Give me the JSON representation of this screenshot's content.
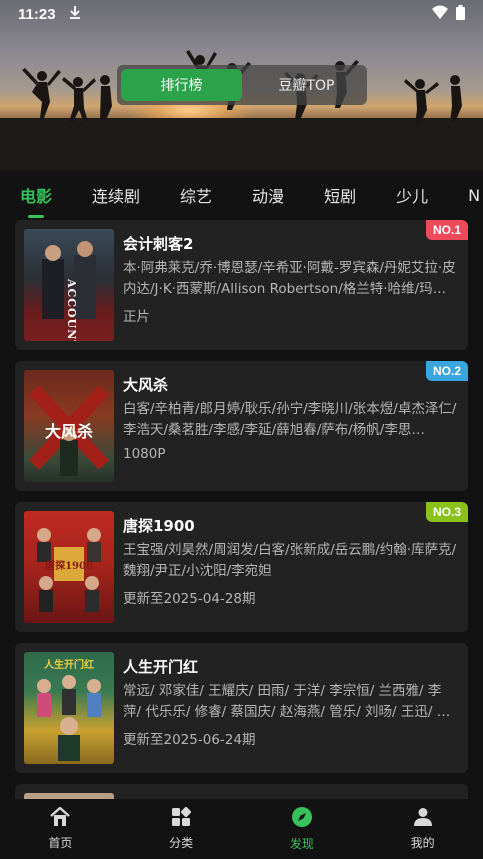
{
  "status_bar": {
    "time": "11:23"
  },
  "header": {
    "segments": [
      {
        "label": "排行榜",
        "active": true
      },
      {
        "label": "豆瓣TOP",
        "active": false
      }
    ]
  },
  "category_tabs": [
    {
      "label": "电影",
      "active": true
    },
    {
      "label": "连续剧",
      "active": false
    },
    {
      "label": "综艺",
      "active": false
    },
    {
      "label": "动漫",
      "active": false
    },
    {
      "label": "短剧",
      "active": false
    },
    {
      "label": "少儿",
      "active": false
    },
    {
      "label": "N",
      "active": false
    }
  ],
  "items": [
    {
      "rank": "NO.1",
      "rank_color": "#ef4a5a",
      "title": "会计刺客2",
      "cast": "本·阿弗莱克/乔·博恩瑟/辛希亚·阿戴-罗宾森/丹妮艾拉·皮内达/J·K·西蒙斯/Allison Robertson/格兰特·哈维/玛…",
      "status": "正片",
      "poster_text": "ACCOUNTANT"
    },
    {
      "rank": "NO.2",
      "rank_color": "#3aa6e0",
      "title": "大风杀",
      "cast": "白客/辛柏青/郎月婷/耿乐/孙宁/李晓川/张本煜/卓杰泽仁/李浩天/桑茗胜/李感/李延/薛旭春/萨布/杨帆/李思…",
      "status": "1080P",
      "poster_text": "大风杀"
    },
    {
      "rank": "NO.3",
      "rank_color": "#8bc21a",
      "title": "唐探1900",
      "cast": "王宝强/刘昊然/周润发/白客/张新成/岳云鹏/约翰·库萨克/魏翔/尹正/小沈阳/李宛妲",
      "status": "更新至2025-04-28期",
      "poster_text": "唐探1900"
    },
    {
      "rank": "",
      "rank_color": "",
      "title": "人生开门红",
      "cast": "常远/ 邓家佳/ 王耀庆/ 田雨/ 于洋/ 李宗恒/ 兰西雅/ 李萍/ 代乐乐/ 修睿/ 蔡国庆/ 赵海燕/ 管乐/ 刘旸/ 王迅/ …",
      "status": "更新至2025-06-24期",
      "poster_text": "人生开门红"
    }
  ],
  "bottom_nav": [
    {
      "label": "首页",
      "icon": "home-icon",
      "active": false
    },
    {
      "label": "分类",
      "icon": "category-icon",
      "active": false
    },
    {
      "label": "发现",
      "icon": "compass-icon",
      "active": true
    },
    {
      "label": "我的",
      "icon": "user-icon",
      "active": false
    }
  ]
}
